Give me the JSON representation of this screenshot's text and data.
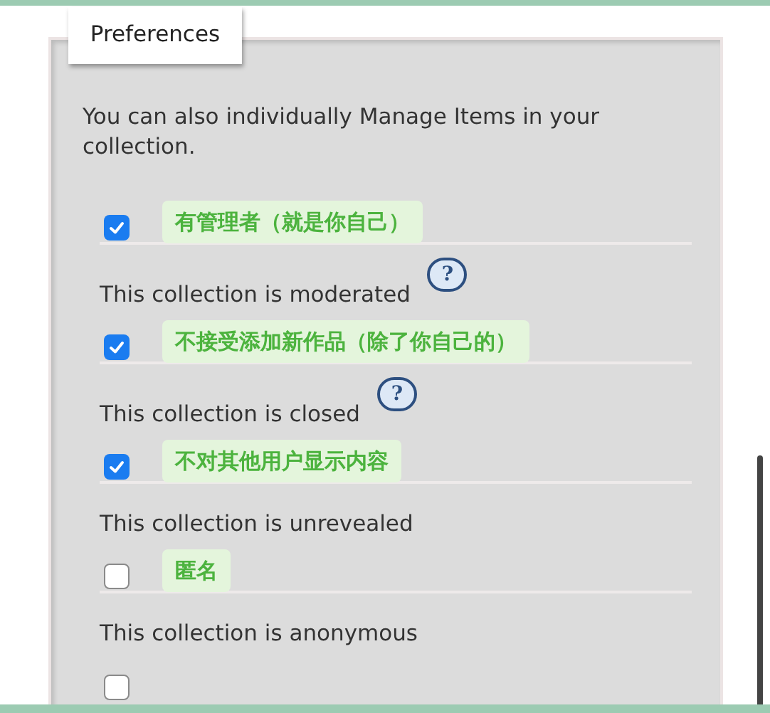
{
  "panel": {
    "title": "Preferences",
    "description": "You can also individually Manage Items in your collection."
  },
  "options": [
    {
      "checked": true,
      "annotation": "有管理者（就是你自己）",
      "label": "This collection is moderated",
      "help": "?"
    },
    {
      "checked": true,
      "annotation": "不接受添加新作品（除了你自己的）",
      "label": "This collection is closed",
      "help": "?"
    },
    {
      "checked": true,
      "annotation": "不对其他用户显示内容",
      "label": "This collection is unrevealed"
    },
    {
      "checked": false,
      "annotation": "匿名",
      "label": "This collection is anonymous"
    },
    {
      "checked": false
    }
  ]
}
